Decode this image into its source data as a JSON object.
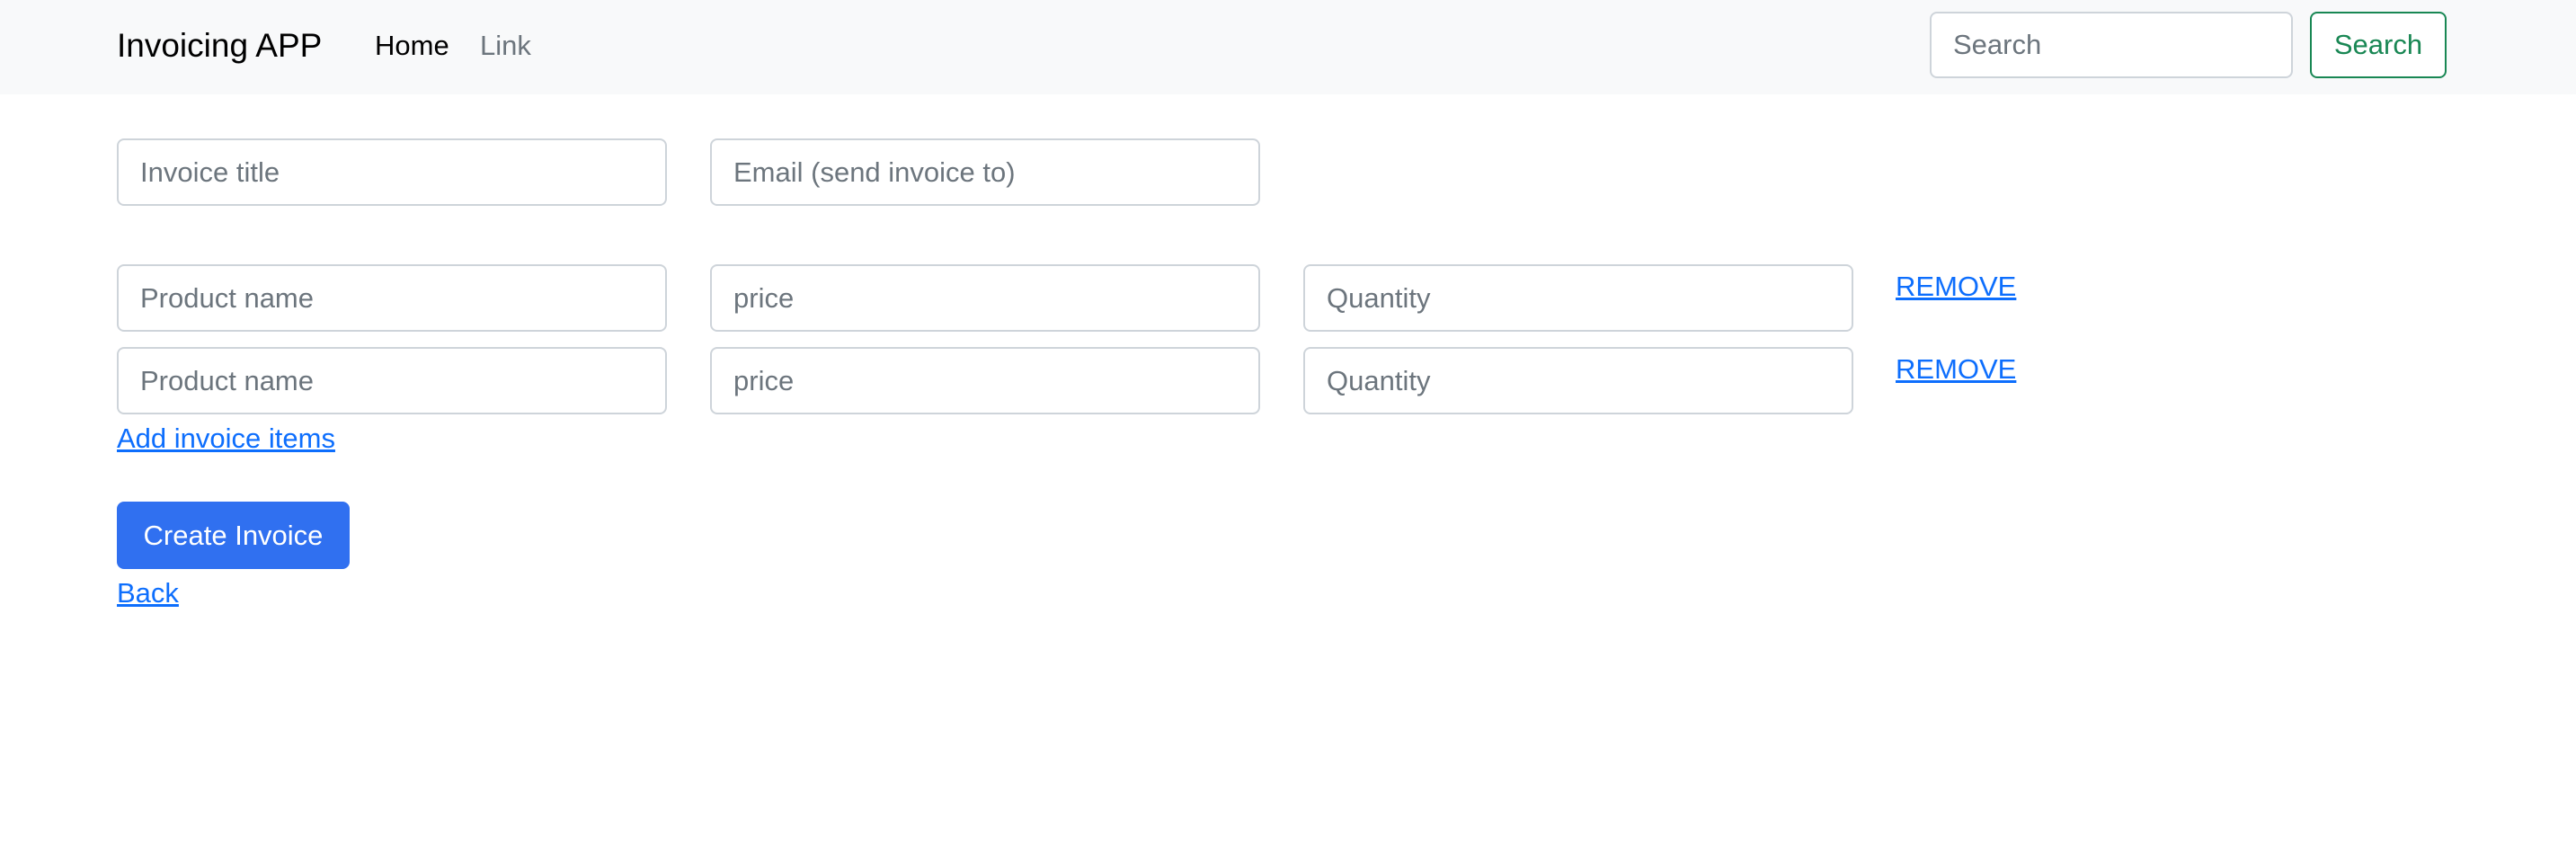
{
  "navbar": {
    "brand": "Invoicing APP",
    "links": [
      "Home",
      "Link"
    ],
    "search_placeholder": "Search",
    "search_button": "Search"
  },
  "form": {
    "invoice_title_placeholder": "Invoice title",
    "email_placeholder": "Email (send invoice to)",
    "items": [
      {
        "product_placeholder": "Product name",
        "price_placeholder": "price",
        "quantity_placeholder": "Quantity",
        "remove_label": "REMOVE"
      },
      {
        "product_placeholder": "Product name",
        "price_placeholder": "price",
        "quantity_placeholder": "Quantity",
        "remove_label": "REMOVE"
      }
    ],
    "add_items_label": "Add invoice items",
    "create_button": "Create Invoice",
    "back_label": "Back"
  },
  "colors": {
    "navbar_bg": "#f8f9fa",
    "primary": "#3070f0",
    "link": "#0d6efd",
    "success": "#198754"
  }
}
